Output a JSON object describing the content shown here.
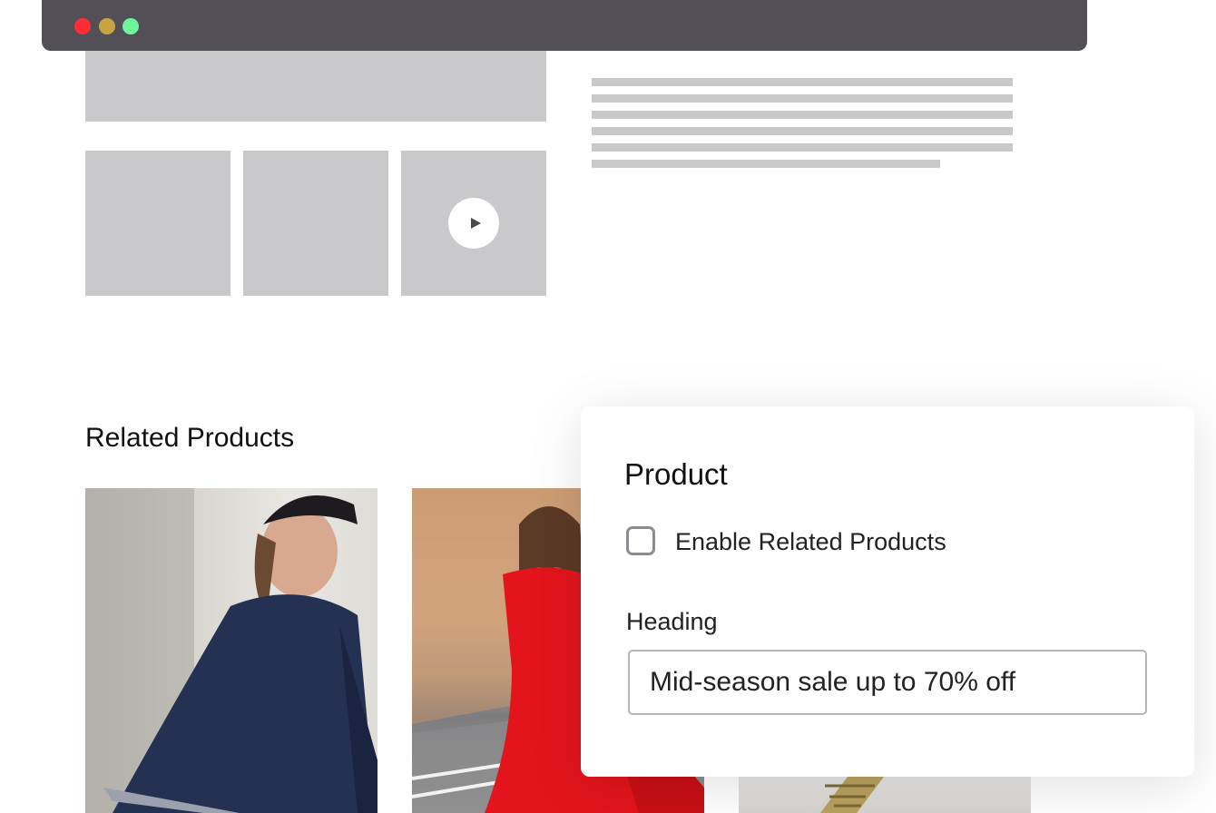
{
  "window": {
    "controls": [
      "close",
      "minimize",
      "maximize"
    ]
  },
  "colors": {
    "window_bar": "#524f57",
    "close": "#fe2d35",
    "minimize": "#c9a33f",
    "maximize": "#6ff59c",
    "placeholder": "#c9c8ca"
  },
  "related": {
    "heading": "Related Products",
    "products": [
      {
        "image": "woman-in-navy-poncho-photo"
      },
      {
        "image": "woman-in-red-dress-photo"
      },
      {
        "image": "gold-heeled-sandal-photo"
      }
    ]
  },
  "settings_panel": {
    "title": "Product",
    "enable_related": {
      "label": "Enable Related Products",
      "checked": false
    },
    "heading_field": {
      "label": "Heading",
      "value": "Mid-season sale up to 70% off"
    }
  }
}
